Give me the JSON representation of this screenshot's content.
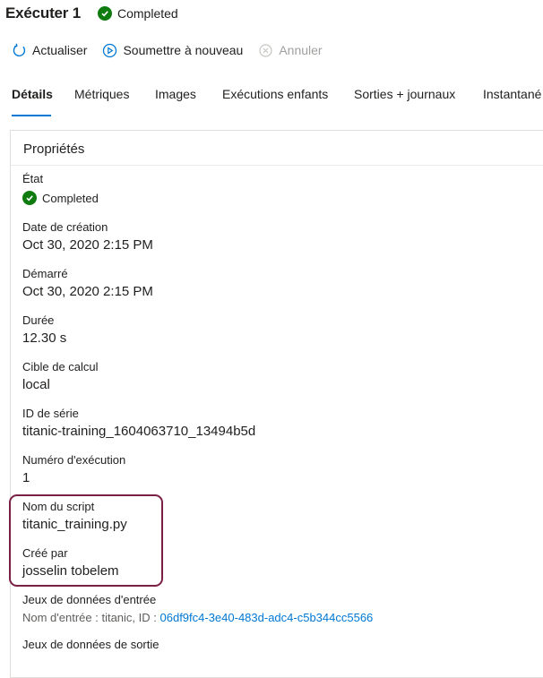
{
  "header": {
    "title": "Exécuter 1",
    "status": "Completed"
  },
  "toolbar": {
    "refresh": "Actualiser",
    "resubmit": "Soumettre à nouveau",
    "cancel": "Annuler"
  },
  "tabs": [
    "Détails",
    "Métriques",
    "Images",
    "Exécutions enfants",
    "Sorties + journaux",
    "Instantané"
  ],
  "properties": {
    "title": "Propriétés",
    "state_label": "État",
    "state_value": "Completed",
    "created_label": "Date de création",
    "created_value": "Oct 30, 2020 2:15 PM",
    "started_label": "Démarré",
    "started_value": "Oct 30, 2020 2:15 PM",
    "duration_label": "Durée",
    "duration_value": "12.30 s",
    "compute_label": "Cible de calcul",
    "compute_value": "local",
    "series_label": "ID de série",
    "series_value": "titanic-training_1604063710_13494b5d",
    "run_number_label": "Numéro d'exécution",
    "run_number_value": "1",
    "script_label": "Nom du script",
    "script_value": "titanic_training.py",
    "creator_label": "Créé par",
    "creator_value": "josselin tobelem",
    "input_datasets_label": "Jeux de données d'entrée",
    "input_dataset_prefix": "Nom d'entrée : titanic, ID : ",
    "input_dataset_id": "06df9fc4-3e40-483d-adc4-c5b344cc5566",
    "output_datasets_label": "Jeux de données de sortie"
  },
  "colors": {
    "accent": "#0078d4",
    "success": "#107c10",
    "highlight": "#7a1f45"
  }
}
